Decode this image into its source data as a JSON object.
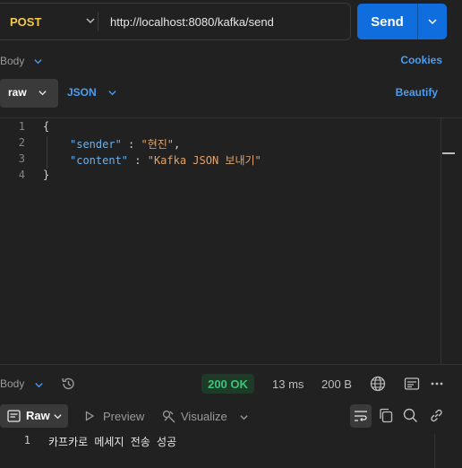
{
  "request": {
    "method": "POST",
    "url": "http://localhost:8080/kafka/send",
    "send_label": "Send"
  },
  "request_tabs": {
    "body_label": "Body",
    "cookies_label": "Cookies",
    "body_mode": "raw",
    "body_format": "JSON",
    "beautify_label": "Beautify"
  },
  "editor": {
    "lines": [
      {
        "n": "1",
        "text": "{"
      },
      {
        "n": "2",
        "key": "\"sender\"",
        "sep": " : ",
        "value": "\"현진\"",
        "tail": ","
      },
      {
        "n": "3",
        "key": "\"content\"",
        "sep": " : ",
        "value": "\"Kafka JSON 보내기\"",
        "tail": ""
      },
      {
        "n": "4",
        "text": "}"
      }
    ]
  },
  "response": {
    "body_label": "Body",
    "status": "200 OK",
    "time": "13 ms",
    "size": "200 B",
    "mode_label": "Raw",
    "preview_label": "Preview",
    "visualize_label": "Visualize",
    "lines": [
      {
        "n": "1",
        "text": "카프카로 메세지 전송 성공"
      }
    ]
  },
  "colors": {
    "accent": "#0f6dde",
    "method": "#f2c94c",
    "status_ok": "#3ec37a",
    "json_key": "#6fb0e8",
    "json_string": "#e0a36e",
    "link_blue": "#4d9cf0"
  },
  "icons": [
    "chevron-down-icon",
    "history-icon",
    "globe-icon",
    "save-example-icon",
    "more-icon",
    "raw-lines-icon",
    "play-icon",
    "visualize-icon",
    "wrap-icon",
    "copy-icon",
    "search-icon",
    "link-icon"
  ]
}
